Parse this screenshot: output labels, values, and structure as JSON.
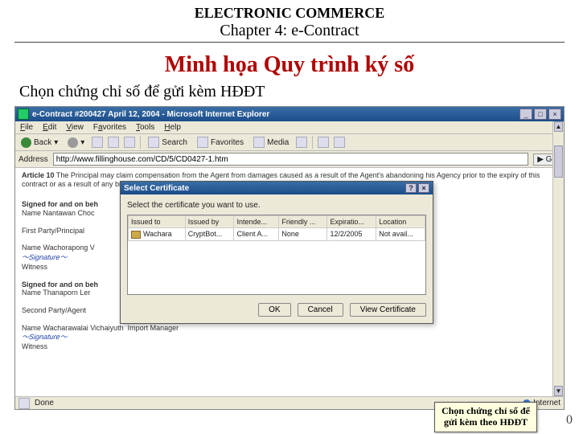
{
  "slide": {
    "header_line1": "ELECTRONIC COMMERCE",
    "header_line2": "Chapter 4: e-Contract",
    "title": "Minh họa Quy trình ký số",
    "subtitle": "Chọn chứng chỉ số để gửi kèm HĐĐT",
    "page_number": "0"
  },
  "browser": {
    "window_title": "e-Contract #200427 April 12, 2004 - Microsoft Internet Explorer",
    "menu": {
      "file": "File",
      "edit": "Edit",
      "view": "View",
      "favorites": "Favorites",
      "tools": "Tools",
      "help": "Help"
    },
    "toolbar": {
      "back": "Back",
      "search": "Search",
      "favorites": "Favorites",
      "media": "Media",
      "history": ""
    },
    "address_label": "Address",
    "address_value": "http://www.fillinghouse.com/CD/5/CD0427-1.htm",
    "go_label": "Go",
    "status_done": "Done",
    "status_zone": "Internet"
  },
  "doc": {
    "article10_label": "Article 10",
    "article10_text": "The Principal may claim compensation from the Agent from damages caused as a result of the Agent's abandoning his Agency prior to the expiry of this contract or as a result of any breach of contract by the Agent.",
    "signed_on_behalf_1": "Signed for and on beh",
    "name1_label": "Name Nantawan Choc",
    "first_party_label": "First Party/Principal",
    "name2_label": "Name",
    "name2_value": "Wachorapong V",
    "witness_label": "Witness",
    "signed_on_behalf_2": "Signed for and on beh",
    "name3_label": "Name Thanaporn Ler",
    "second_party_label": "Second Party/Agent",
    "name4_label": "Name",
    "name4_value": "Wacharawalai Vichaiyuth",
    "role4": "Import Manager"
  },
  "modal": {
    "title": "Select Certificate",
    "prompt": "Select the certificate you want to use.",
    "columns": [
      "Issued to",
      "Issued by",
      "Intende...",
      "Friendly ...",
      "Expiratio...",
      "Location"
    ],
    "rows": [
      {
        "issued_to": "Wachara",
        "issued_by": "CryptBot...",
        "intended": "Client A...",
        "friendly": "None",
        "expiry": "12/2/2005",
        "location": "Not avail..."
      }
    ],
    "ok": "OK",
    "cancel": "Cancel",
    "view": "View Certificate"
  },
  "callout": {
    "line1": "Chọn chứng chỉ số để",
    "line2": "gửi kèm theo HĐĐT"
  }
}
